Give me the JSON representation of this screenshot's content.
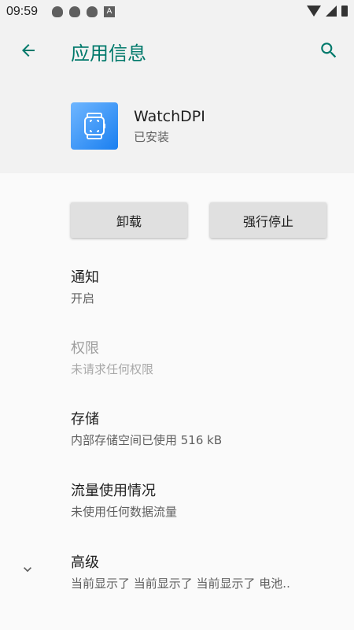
{
  "status_bar": {
    "time": "09:59",
    "notif_icons": [
      "qq-icon",
      "qq-icon",
      "qq-icon",
      "a-icon"
    ],
    "a_letter": "A"
  },
  "header": {
    "title": "应用信息",
    "back_icon": "arrow-back-icon",
    "search_icon": "search-icon"
  },
  "app": {
    "name": "WatchDPI",
    "status": "已安装",
    "icon": "watch-icon"
  },
  "buttons": {
    "uninstall": "卸载",
    "force_stop": "强行停止"
  },
  "items": [
    {
      "title": "通知",
      "summary": "开启",
      "enabled": true
    },
    {
      "title": "权限",
      "summary": "未请求任何权限",
      "enabled": false
    },
    {
      "title": "存储",
      "summary": "内部存储空间已使用 516 kB",
      "enabled": true
    },
    {
      "title": "流量使用情况",
      "summary": "未使用任何数据流量",
      "enabled": true
    },
    {
      "title": "高级",
      "summary": "当前显示了 当前显示了 当前显示了 电池..",
      "enabled": true
    }
  ],
  "colors": {
    "accent": "#00796b",
    "header_bg": "#f2f2f2",
    "body_bg": "#fafafa"
  }
}
